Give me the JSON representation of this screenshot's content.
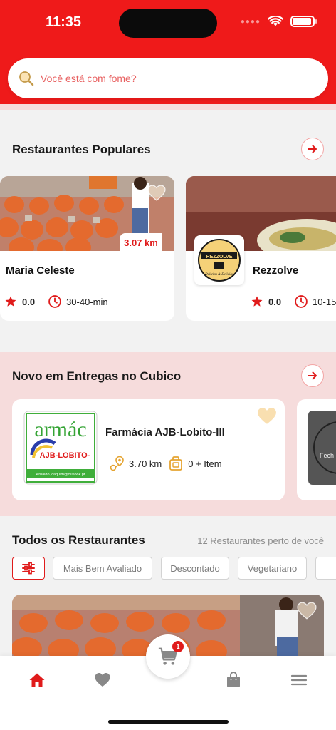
{
  "status_bar": {
    "time": "11:35"
  },
  "search": {
    "placeholder": "Você está com fome?"
  },
  "popular": {
    "title": "Restaurantes Populares",
    "cards": [
      {
        "name": "Maria Celeste",
        "distance": "3.07 km",
        "rating": "0.0",
        "time": "30-40-min"
      },
      {
        "name": "Rezzolve",
        "rating": "0.0",
        "time": "10-15",
        "logo_text_top": "REZZOLVE",
        "logo_text_bottom": "Delicias & Delicias"
      }
    ]
  },
  "novo": {
    "title": "Novo em Entregas no Cubico",
    "cards": [
      {
        "name": "Farmácia AJB-Lobito-III",
        "distance": "3.70 km",
        "items": "0 + Item",
        "logo_top": "armác",
        "logo_mid": "AJB-LOBITO-",
        "logo_bottom": "Arnaldo.jcaquim@outlook.pt"
      },
      {
        "logo_text": "Fech"
      }
    ]
  },
  "all": {
    "title": "Todos os Restaurantes",
    "count_text": "12 Restaurantes perto de você",
    "chips": [
      "Mais Bem Avaliado",
      "Descontado",
      "Vegetariano"
    ]
  },
  "cart": {
    "badge": "1"
  },
  "colors": {
    "brand_red": "#ef1a1a",
    "pink_bg": "#f6dcdc"
  },
  "icons": [
    "search-icon",
    "arrow-right-icon",
    "star-icon",
    "clock-icon",
    "heart-icon",
    "location-icon",
    "bag-icon",
    "filter-icon",
    "home-icon",
    "cart-icon",
    "menu-icon"
  ]
}
